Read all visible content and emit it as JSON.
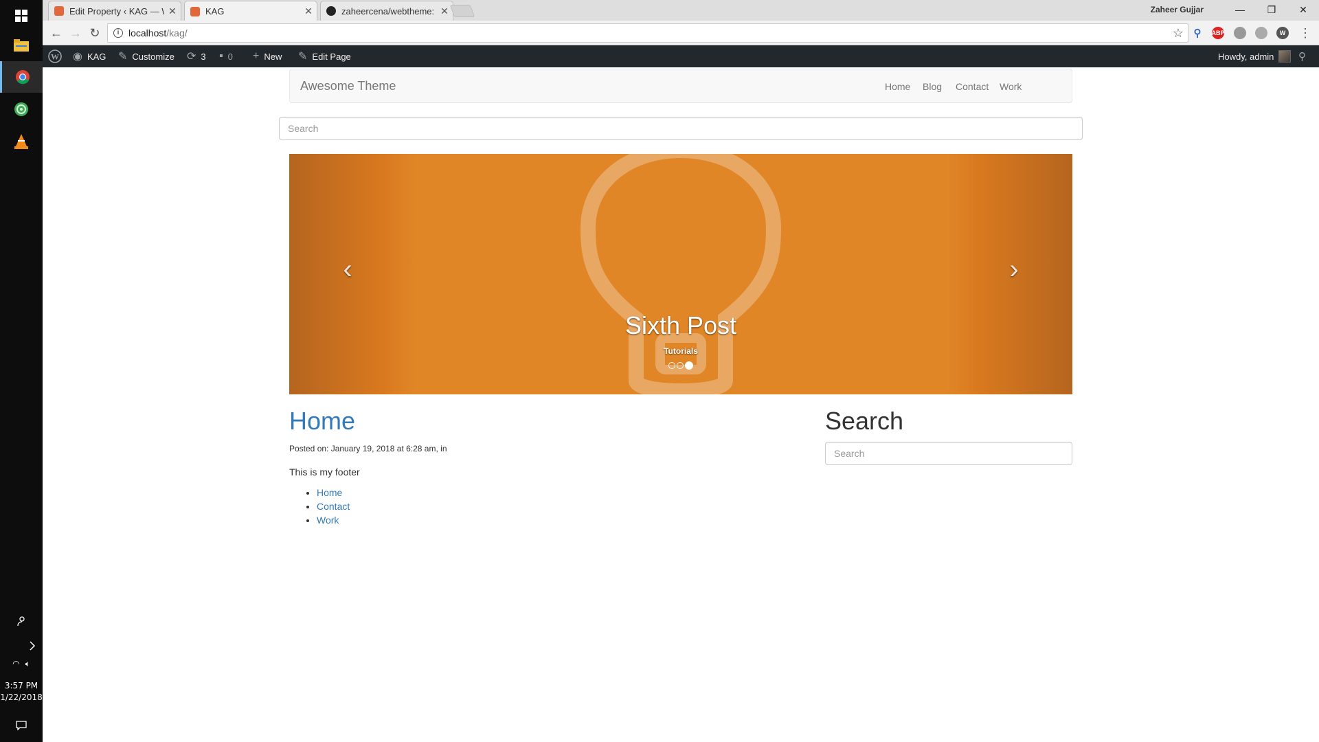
{
  "taskbar": {
    "apps": [
      {
        "name": "windows-start-icon"
      },
      {
        "name": "file-explorer-icon"
      },
      {
        "name": "chrome-icon"
      },
      {
        "name": "app-icon"
      },
      {
        "name": "vlc-icon"
      }
    ],
    "clock": {
      "time": "3:57 PM",
      "date": "1/22/2018"
    }
  },
  "browser": {
    "user_name": "Zaheer Gujjar",
    "tabs": [
      {
        "title": "Edit Property ‹ KAG — W",
        "active": false
      },
      {
        "title": "KAG",
        "active": true
      },
      {
        "title": "zaheercena/webtheme: T",
        "active": false
      }
    ],
    "url": {
      "host": "localhost",
      "path": "/kag/"
    }
  },
  "wp_admin_bar": {
    "site_name": "KAG",
    "customize": "Customize",
    "updates_count": "3",
    "comments_count": "0",
    "new_label": "New",
    "edit_label": "Edit Page",
    "greeting": "Howdy, admin"
  },
  "site": {
    "brand": "Awesome Theme",
    "menu": [
      "Home",
      "Blog",
      "Contact",
      "Work"
    ],
    "search_placeholder": "Search",
    "carousel": {
      "title": "Sixth Post",
      "category": "Tutorials",
      "slide_count": 3,
      "active_index": 2
    },
    "post": {
      "title": "Home",
      "meta": "Posted on: January 19, 2018 at 6:28 am, in",
      "body": "This is my footer",
      "footer_links": [
        "Home",
        "Contact",
        "Work"
      ]
    },
    "sidebar": {
      "widget_title": "Search",
      "search_placeholder": "Search"
    }
  },
  "colors": {
    "link": "#337ab7",
    "carousel_bg": "#e08627",
    "wp_bar": "#23282d"
  }
}
